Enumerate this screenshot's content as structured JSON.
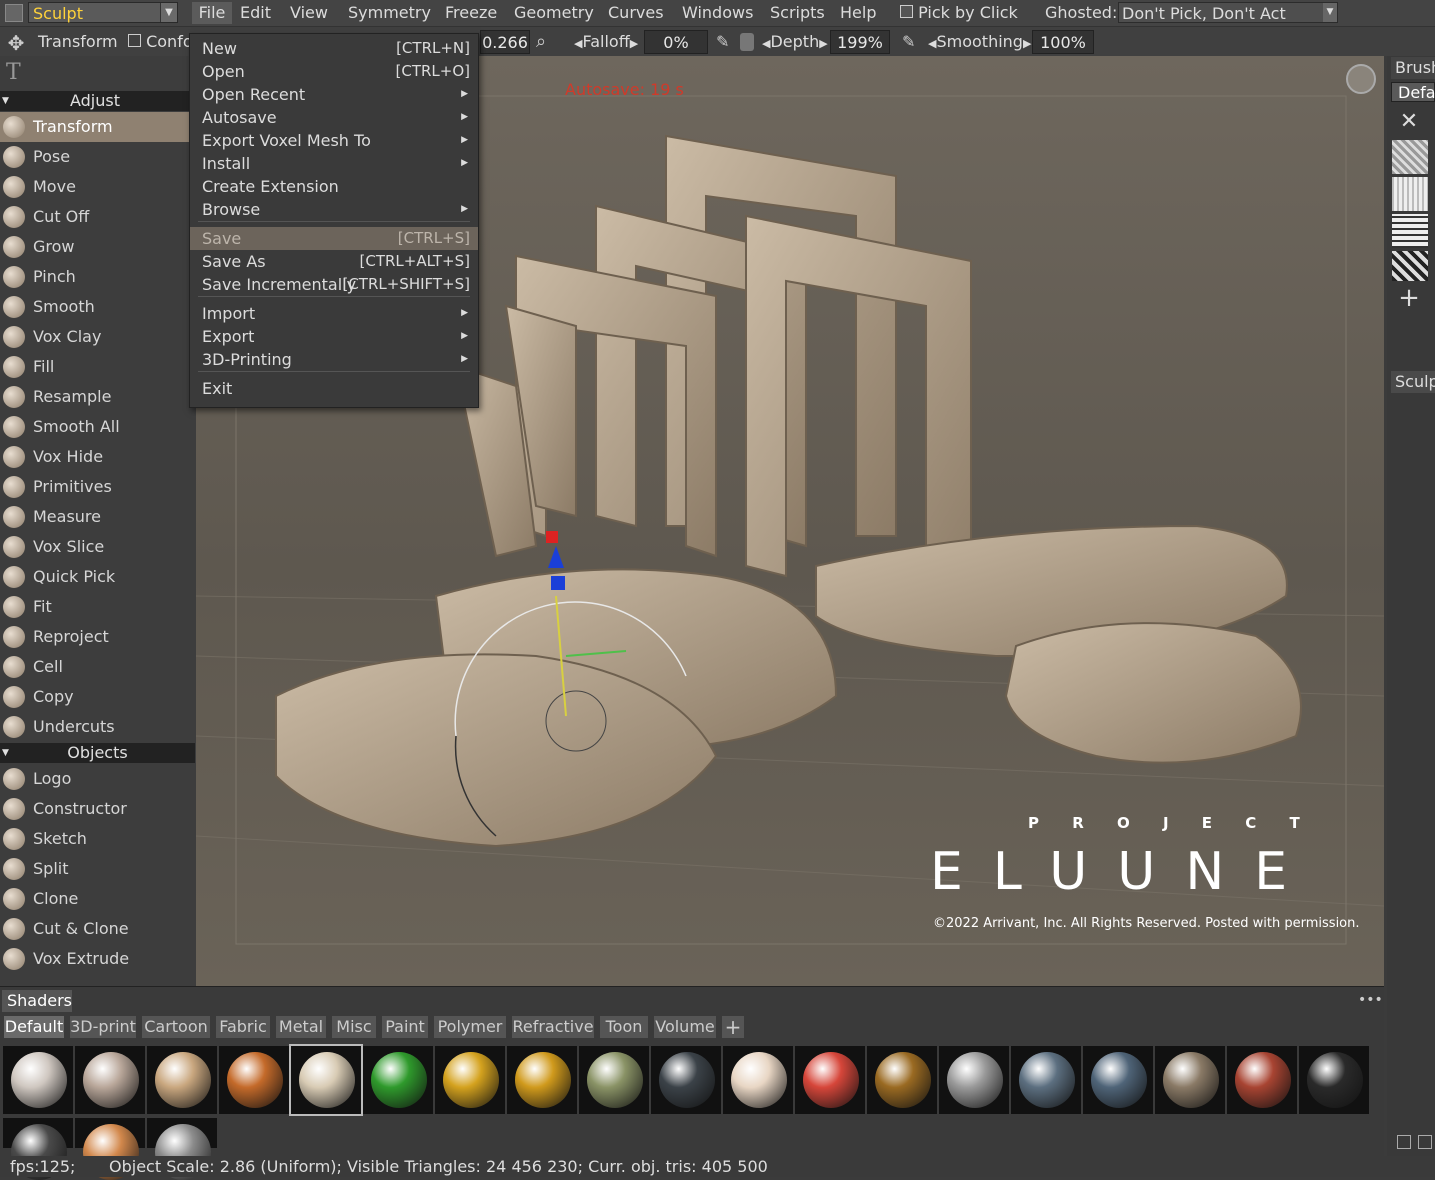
{
  "menubar": {
    "room": "Sculpt",
    "items": [
      "File",
      "Edit",
      "View",
      "Symmetry",
      "Freeze",
      "Geometry",
      "Curves",
      "Windows",
      "Scripts",
      "Help"
    ],
    "pick_by_click": "Pick by Click",
    "ghosted_label": "Ghosted:",
    "ghosted_value": "Don't Pick, Don't Act"
  },
  "toolbar": {
    "transform": "Transform",
    "conform": "Confo",
    "value1": "0.266",
    "falloff_label": "Falloff",
    "falloff_value": "0%",
    "depth_label": "Depth",
    "depth_value": "199%",
    "smoothing_label": "Smoothing",
    "smoothing_value": "100%"
  },
  "left_panel": {
    "adjust_header": "Adjust",
    "adjust_tools": [
      "Transform",
      "Pose",
      "Move",
      "Cut Off",
      "Grow",
      "Pinch",
      "Smooth",
      "Vox Clay",
      "Fill",
      "Resample",
      "Smooth All",
      "Vox Hide",
      "Primitives",
      "Measure",
      "Vox Slice",
      "Quick Pick",
      "Fit",
      "Reproject",
      "Cell",
      "Copy",
      "Undercuts"
    ],
    "objects_header": "Objects",
    "object_tools": [
      "Logo",
      "Constructor",
      "Sketch",
      "Split",
      "Clone",
      "Cut & Clone",
      "Vox Extrude"
    ]
  },
  "file_menu": {
    "items": [
      {
        "label": "New",
        "shortcut": "[CTRL+N]"
      },
      {
        "label": "Open",
        "shortcut": "[CTRL+O]"
      },
      {
        "label": "Open Recent",
        "shortcut": ""
      },
      {
        "label": "Autosave",
        "shortcut": ""
      },
      {
        "label": "Export Voxel Mesh To",
        "shortcut": ""
      },
      {
        "label": "Install",
        "shortcut": ""
      },
      {
        "label": "Create Extension",
        "shortcut": ""
      },
      {
        "label": "Browse",
        "shortcut": ""
      },
      {
        "label": "Save",
        "shortcut": "[CTRL+S]"
      },
      {
        "label": "Save As",
        "shortcut": "[CTRL+ALT+S]"
      },
      {
        "label": "Save Incrementally",
        "shortcut": "[CTRL+SHIFT+S]"
      },
      {
        "label": "Import",
        "shortcut": ""
      },
      {
        "label": "Export",
        "shortcut": ""
      },
      {
        "label": "3D-Printing",
        "shortcut": ""
      },
      {
        "label": "Exit",
        "shortcut": ""
      }
    ]
  },
  "viewport": {
    "autosave": "Autosave: 19 s",
    "watermark_project": "P R O J E C T",
    "watermark_title": "ELUUNE",
    "copyright": "©2022 Arrivant, Inc. All Rights Reserved. Posted with permission."
  },
  "right_panel": {
    "brush_tab": "Brush",
    "default_label": "Defau",
    "sculpt_tab": "Sculp"
  },
  "shaders": {
    "title": "Shaders",
    "tabs": [
      "Default",
      "3D-print",
      "Cartoon",
      "Fabric",
      "Metal",
      "Misc",
      "Paint",
      "Polymer",
      "Refractive",
      "Toon",
      "Volume"
    ],
    "colors": [
      "#cfc7c0",
      "#b9a79a",
      "#c9a77f",
      "#c46a2a",
      "#d8cbb4",
      "#2f9a2c",
      "#d4a21e",
      "#d09a1c",
      "#8a9366",
      "#3b4248",
      "#e8d6c4",
      "#d6463a",
      "#9a6a22",
      "#9a9a9a",
      "#5c6f80",
      "#4f6478",
      "#8a7a66",
      "#a84432",
      "#2a2a2a",
      "#4a4a4a",
      "#d2884c",
      "#8c8c8c"
    ]
  },
  "status": {
    "fps": "fps:125;",
    "info": "Object Scale: 2.86 (Uniform); Visible Triangles: 24 456 230; Curr. obj. tris: 405 500"
  }
}
